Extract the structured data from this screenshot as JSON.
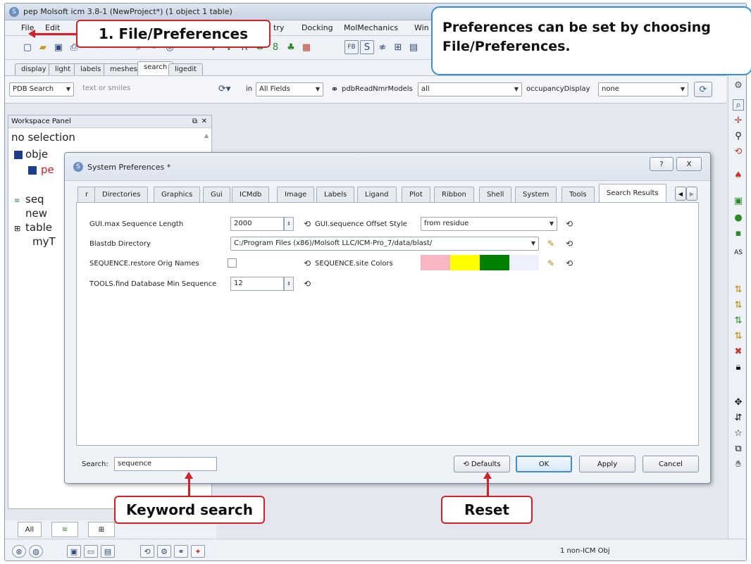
{
  "window": {
    "title": "pep Molsoft icm 3.8-1 (NewProject*) (1 object 1 table)"
  },
  "menu": [
    "File",
    "Edit",
    "try",
    "Docking",
    "MolMechanics",
    "Win"
  ],
  "toolbar_icons": [
    "new-icon",
    "open-icon",
    "save-icon",
    "print-icon",
    "undo-icon",
    "redo-icon",
    "find-icon",
    "binoculars-icon",
    "target-icon",
    "molecule-icon",
    "molecule2-icon",
    "text-icon",
    "chem-icon",
    "bond-icon",
    "chem2-icon",
    "grid-icon",
    "fb-icon",
    "sequence-icon",
    "align-icon",
    "table-icon",
    "edit-icon"
  ],
  "toolbar_tabs": [
    "display",
    "light",
    "labels",
    "meshes",
    "search",
    "ligedit"
  ],
  "search_bar": {
    "source": "PDB Search",
    "query_placeholder": "text or smiles",
    "in_label": "in",
    "field": "All Fields",
    "nmr_label": "pdbReadNmrModels",
    "nmr_value": "all",
    "occ_label": "occupancyDisplay",
    "occ_value": "none"
  },
  "workspace": {
    "title": "Workspace Panel",
    "selection": "no selection",
    "tree": [
      "obje",
      "pe",
      "seq",
      "new",
      "table",
      "myT"
    ]
  },
  "dialog": {
    "title": "System Preferences *",
    "help": "?",
    "close": "X",
    "tabs": [
      "r",
      "Directories",
      "Graphics",
      "Gui",
      "ICMdb",
      "Image",
      "Labels",
      "Ligand",
      "Plot",
      "Ribbon",
      "Shell",
      "System",
      "Tools",
      "Search Results"
    ],
    "active_tab": "Search Results",
    "rows": {
      "max_seq_label": "GUI.max Sequence Length",
      "max_seq_value": "2000",
      "offset_label": "GUI.sequence Offset Style",
      "offset_value": "from residue",
      "blast_label": "Blastdb Directory",
      "blast_value": "C:/Program Files (x86)/Molsoft LLC/ICM-Pro_7/data/blast/",
      "restore_label": "SEQUENCE.restore Orig Names",
      "colors_label": "SEQUENCE.site Colors",
      "colors": [
        "#f7b6c2",
        "#ffff00",
        "#008000",
        "#eef0fb"
      ],
      "tools_label": "TOOLS.find Database Min Sequence",
      "tools_value": "12"
    },
    "search_label": "Search:",
    "search_value": "sequence",
    "defaults": "Defaults",
    "ok": "OK",
    "apply": "Apply",
    "cancel": "Cancel"
  },
  "bottom_tabs": [
    "All"
  ],
  "status": {
    "text": "1 non-ICM Obj"
  },
  "annotations": {
    "file_prefs": "1. File/Preferences",
    "bubble": "Preferences can be set by choosing File/Preferences.",
    "keyword": "Keyword search",
    "reset": "Reset"
  },
  "colors": {
    "callout": "#d3212a",
    "bubble_border": "#3a8fd8",
    "default_button": "#3c8ed6"
  }
}
